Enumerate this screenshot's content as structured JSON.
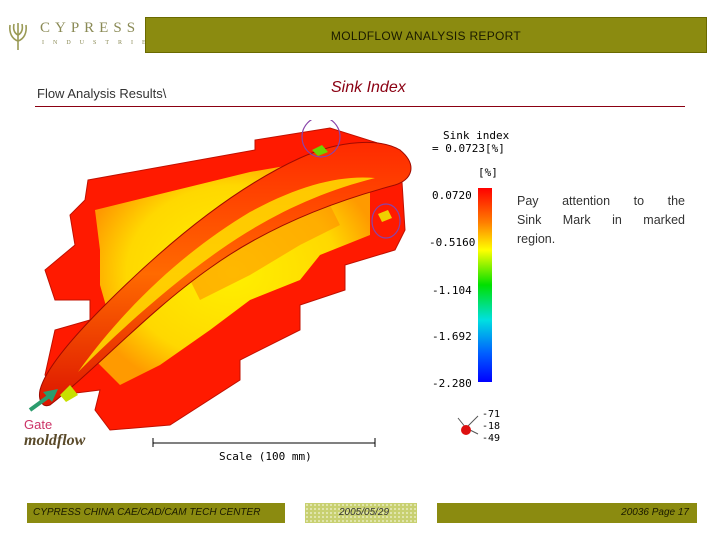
{
  "header": {
    "logo_word": "CYPRESS",
    "logo_sub": "INDUSTRIES",
    "title": "MOLDFLOW ANALYSIS REPORT"
  },
  "page": {
    "section_title": "Flow Analysis Results\\",
    "plot_title": "Sink Index"
  },
  "plot": {
    "result_name": "Sink index",
    "result_value": "= 0.0723[%]",
    "legend_unit": "[%]",
    "legend_ticks": [
      "0.0720",
      "-0.5160",
      "-1.104",
      "-1.692",
      "-2.280"
    ],
    "scale_label": "Scale (100 mm)",
    "axis_values": [
      "-71",
      "-18",
      "-49"
    ],
    "gate_label": "Gate",
    "software_logo": "moldflow"
  },
  "note": {
    "line1": "Pay attention to the",
    "line2": "Sink Mark in marked",
    "line3": "region."
  },
  "footer": {
    "left": "CYPRESS CHINA CAE/CAD/CAM TECH CENTER",
    "date": "2005/05/29",
    "right": "20036 Page 17"
  }
}
